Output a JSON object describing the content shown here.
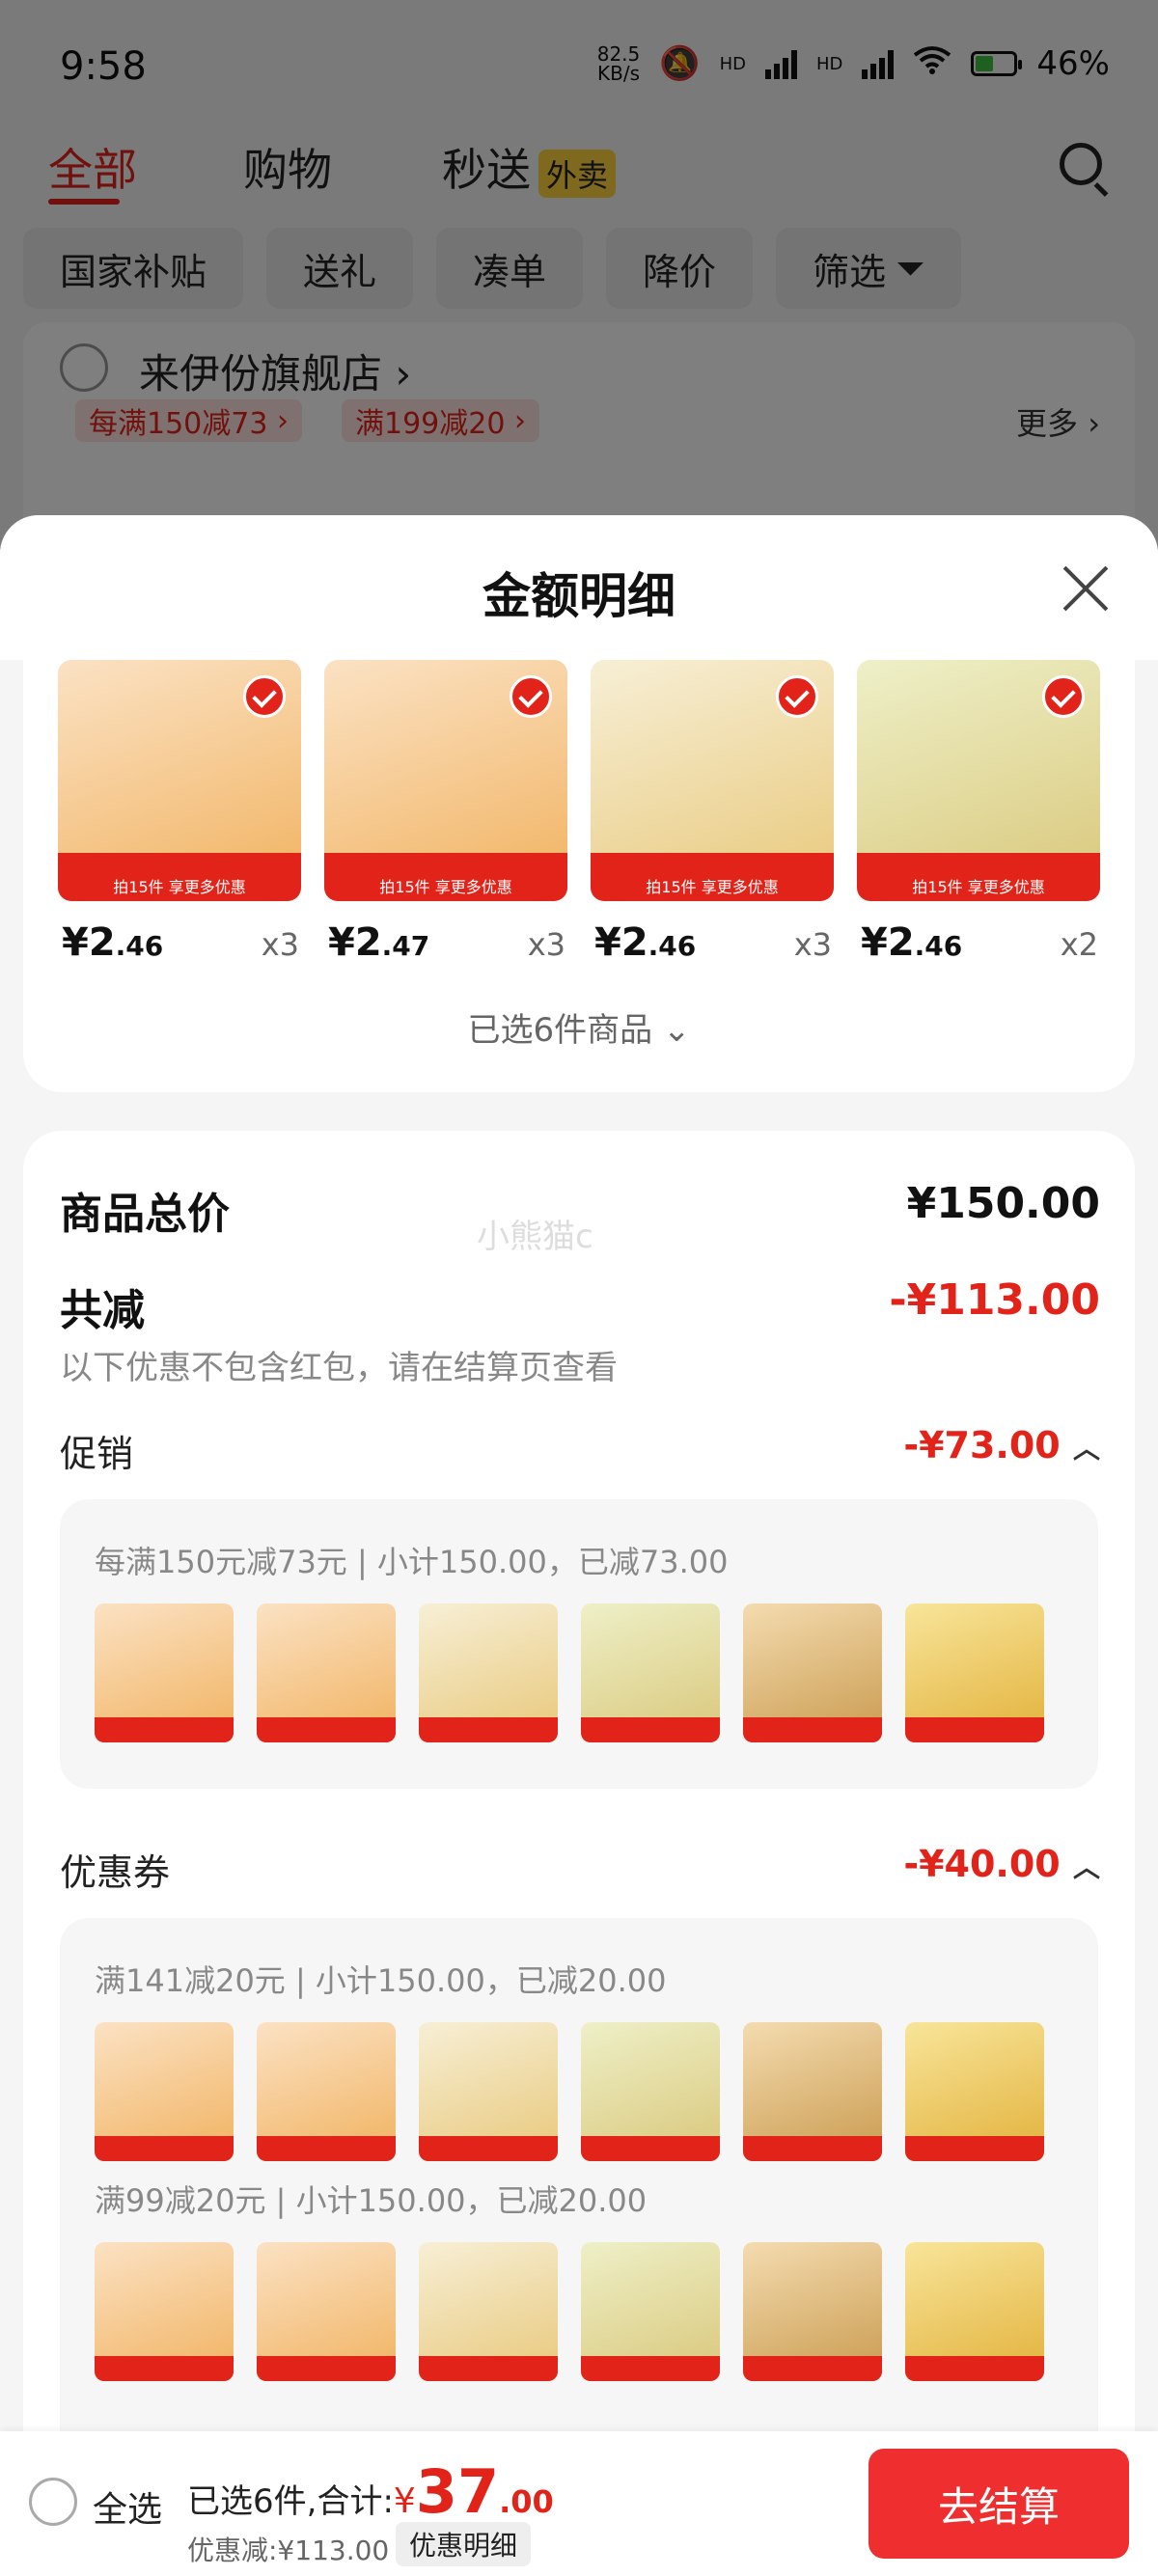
{
  "status_bar": {
    "time": "9:58",
    "speed_value": "82.5",
    "speed_unit": "KB/s",
    "network_labels": [
      "HD",
      "HD"
    ],
    "battery": "46%"
  },
  "top_nav": {
    "tabs": [
      {
        "label": "全部"
      },
      {
        "label": "购物"
      },
      {
        "label": "秒送"
      }
    ],
    "waimai_badge": "外卖"
  },
  "filters": [
    "国家补贴",
    "送礼",
    "凑单",
    "降价",
    "筛选"
  ],
  "store": {
    "name": "来伊份旗舰店",
    "promo_tags": [
      "每满150减73",
      "满199减20"
    ],
    "more_label": "更多"
  },
  "sheet": {
    "title": "金额明细",
    "products": [
      {
        "price_int": "¥2",
        "price_dec": ".46",
        "qty": "x3",
        "banner": "拍15件 享更多优惠"
      },
      {
        "price_int": "¥2",
        "price_dec": ".47",
        "qty": "x3",
        "banner": "拍15件 享更多优惠"
      },
      {
        "price_int": "¥2",
        "price_dec": ".46",
        "qty": "x3",
        "banner": "拍15件 享更多优惠"
      },
      {
        "price_int": "¥2",
        "price_dec": ".46",
        "qty": "x2",
        "banner": "拍15件 享更多优惠"
      }
    ],
    "selected_count_label": "已选6件商品",
    "total_label": "商品总价",
    "total_value": "¥150.00",
    "watermark": "小熊猫c",
    "discount_label": "共减",
    "discount_value": "-¥113.00",
    "discount_note": "以下优惠不包含红包，请在结算页查看",
    "promo_label": "促销",
    "promo_value": "-¥73.00",
    "promo_desc": "每满150元减73元 | 小计150.00，已减73.00",
    "coupon_label": "优惠券",
    "coupon_value": "-¥40.00",
    "coupon_desc_1": "满141减20元 | 小计150.00，已减20.00",
    "coupon_desc_2": "满99减20元 | 小计150.00，已减20.00"
  },
  "bottom_bar": {
    "select_all": "全选",
    "selected_total_prefix": "已选6件,合计:",
    "currency": "¥",
    "total_int": "37",
    "total_dec": ".00",
    "discount_text": "优惠减:¥113.00",
    "detail_button": "优惠明细",
    "checkout_button": "去结算"
  },
  "colors": {
    "accent_red": "#e2231a",
    "checkout_red": "#ef2f2f"
  }
}
